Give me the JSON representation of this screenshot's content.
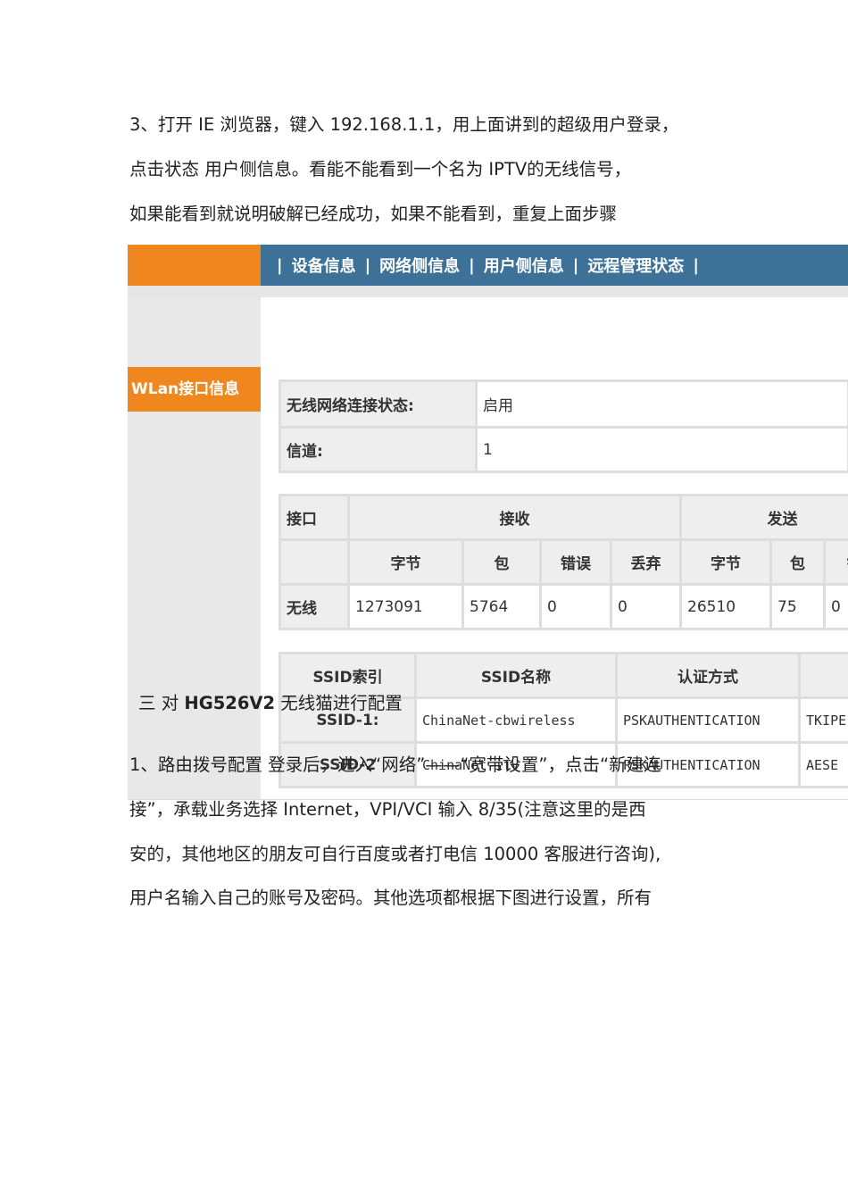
{
  "para1": [
    "3、打开 IE 浏览器，键入 192.168.1.1，用上面讲到的超级用户登录，",
    "点击状态   用户侧信息。看能不能看到一个名为    IPTV的无线信号，",
    "如果能看到就说明破解已经成功，如果不能看到，重复上面步骤"
  ],
  "router": {
    "nav": [
      "|",
      "设备信息",
      "|",
      "网络侧信息",
      "|",
      "用户侧信息",
      "|",
      "远程管理状态",
      "|"
    ],
    "side_item": "WLan接口信息",
    "status": [
      {
        "label": "无线网络连接状态:",
        "value": "启用"
      },
      {
        "label": "信道:",
        "value": "1"
      }
    ],
    "stats": {
      "h_iface": "接口",
      "h_rx": "接收",
      "h_tx": "发送",
      "sub": [
        "字节",
        "包",
        "错误",
        "丢弃",
        "字节",
        "包",
        "错"
      ],
      "row_label": "无线",
      "values": [
        "1273091",
        "5764",
        "0",
        "0",
        "26510",
        "75",
        "0"
      ]
    },
    "ssid": {
      "headers": [
        "SSID索引",
        "SSID名称",
        "认证方式",
        ""
      ],
      "rows": [
        [
          "SSID-1:",
          "ChinaNet-cbwireless",
          "PSKAUTHENTICATION",
          "TKIPE"
        ],
        [
          "SSID-2",
          "ChinaNet-iTV",
          "PSKAUTHENTICATION",
          "AESE"
        ]
      ]
    }
  },
  "heading3": {
    "pre": "三  对 ",
    "bold": "HG526V2",
    "post": " 无线猫进行配置"
  },
  "para2": [
    "1、路由拨号配置  登录后，进入“网络”——“宽带设置”，点击“新建连",
    "接”，承载业务选择 Internet，VPI/VCI  输入 8/35(注意这里的是西",
    "安的，其他地区的朋友可自行百度或者打电信 10000 客服进行咨询),",
    "用户名输入自己的账号及密码。其他选项都根据下图进行设置，所有"
  ]
}
